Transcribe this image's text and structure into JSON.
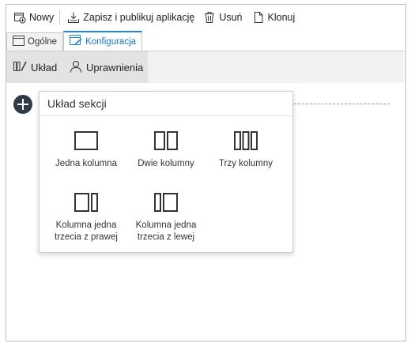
{
  "toolbar": {
    "new_label": "Nowy",
    "save_publish_label": "Zapisz i publikuj aplikację",
    "delete_label": "Usuń",
    "clone_label": "Klonuj"
  },
  "tabs": [
    {
      "label": "Ogólne",
      "active": false,
      "icon": "window-icon"
    },
    {
      "label": "Konfiguracja",
      "active": true,
      "icon": "edit-window-icon"
    }
  ],
  "subtoolbar": {
    "layout_label": "Układ",
    "permissions_label": "Uprawnienia"
  },
  "section_layout": {
    "title": "Układ sekcji",
    "options": [
      {
        "label": "Jedna kolumna",
        "icon": "one-column-icon"
      },
      {
        "label": "Dwie kolumny",
        "icon": "two-columns-icon"
      },
      {
        "label": "Trzy kolumny",
        "icon": "three-columns-icon"
      },
      {
        "label": "Kolumna jedna trzecia z prawej",
        "icon": "one-third-right-icon"
      },
      {
        "label": "Kolumna jedna trzecia z lewej",
        "icon": "one-third-left-icon"
      }
    ]
  },
  "colors": {
    "accent": "#1e88d6",
    "add_button": "#2f3a48"
  }
}
